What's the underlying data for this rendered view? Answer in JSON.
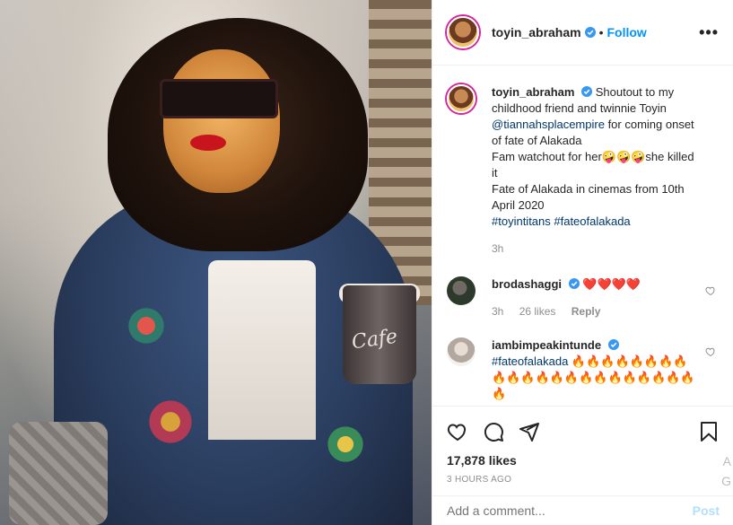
{
  "post": {
    "username": "toyin_abraham",
    "follow_label": "Follow",
    "more_label": "•••",
    "separator": "•"
  },
  "caption": {
    "username": "toyin_abraham",
    "text_1": " Shoutout to my childhood friend and twinnie Toyin ",
    "mention": "@tiannahsplacempire",
    "text_2": " for coming onset of fate of Alakada",
    "text_3": "Fam watchout for her",
    "emoji_3": "🤪🤪🤪",
    "text_4": "she killed it",
    "text_5": "Fate of Alakada in cinemas from 10th April 2020",
    "hashtags": "#toyintitans #fateofalakada",
    "time": "3h"
  },
  "comments": [
    {
      "username": "brodashaggi",
      "text": "❤️❤️❤️❤️",
      "time": "3h",
      "likes": "26 likes",
      "reply": "Reply"
    },
    {
      "username": "iambimpeakintunde",
      "hashtag": "#fateofalakada",
      "text": " 🔥🔥🔥🔥🔥🔥🔥🔥🔥🔥🔥🔥🔥🔥🔥🔥🔥🔥🔥🔥🔥🔥🔥"
    }
  ],
  "actions": {
    "likes": "17,878 likes",
    "age": "3 HOURS AGO"
  },
  "add_comment": {
    "placeholder": "Add a comment...",
    "post_label": "Post"
  },
  "photo": {
    "cup_text": "Cafe"
  },
  "edge": {
    "letter_a": "A",
    "letter_g": "G"
  },
  "colors": {
    "link_blue": "#0095f6",
    "verified_blue": "#3897f0",
    "tag_blue": "#00376b",
    "muted": "#8e8e8e"
  },
  "icons": [
    "verified-icon",
    "more-icon",
    "heart-icon",
    "comment-icon",
    "share-icon",
    "bookmark-icon"
  ]
}
